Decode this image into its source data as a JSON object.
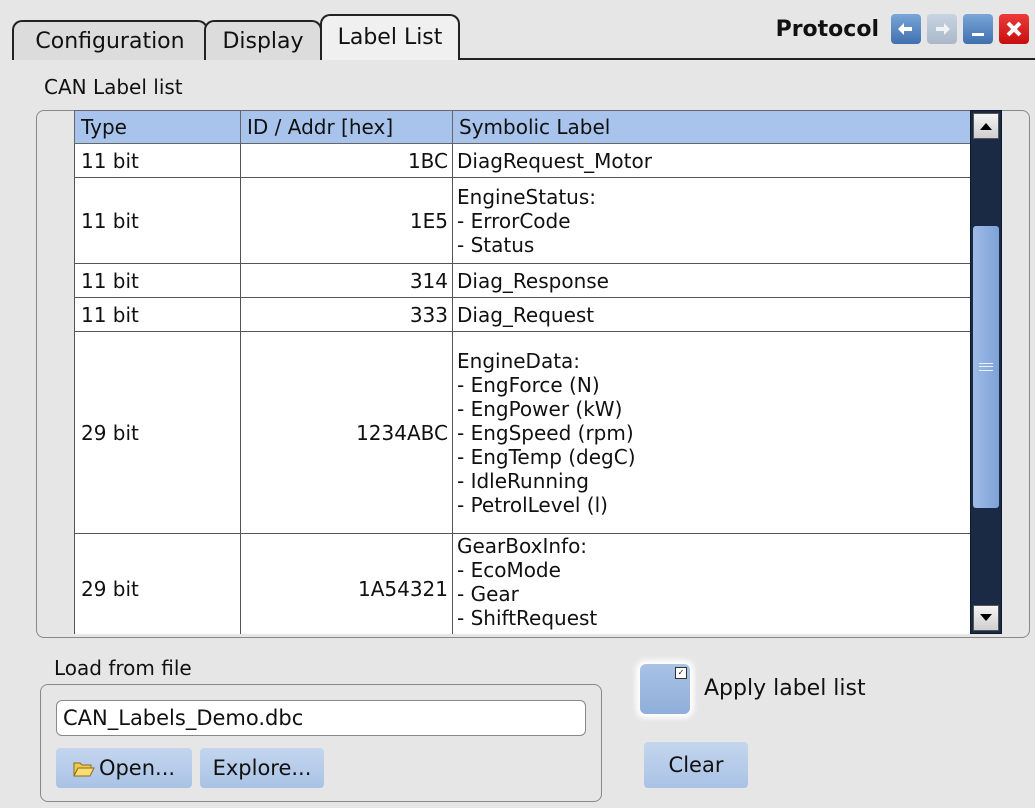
{
  "tabs": [
    {
      "label": "Configuration"
    },
    {
      "label": "Display"
    },
    {
      "label": "Label List"
    }
  ],
  "window": {
    "title": "Protocol",
    "undo_icon": "undo-arrow",
    "redo_icon": "redo-arrow",
    "minimize_icon": "minimize",
    "close_icon": "close-x",
    "accent": "#3f6fae",
    "close_color": "#c80f0f"
  },
  "label_list": {
    "group_title": "CAN Label list",
    "columns": [
      "Type",
      "ID / Addr [hex]",
      "Symbolic Label"
    ],
    "header_color": "#a8c4ec",
    "rows": [
      {
        "type": "11 bit",
        "id": "1BC",
        "label": "DiagRequest_Motor"
      },
      {
        "type": "11 bit",
        "id": "1E5",
        "label": "EngineStatus:\n- ErrorCode\n- Status"
      },
      {
        "type": "11 bit",
        "id": "314",
        "label": "Diag_Response"
      },
      {
        "type": "11 bit",
        "id": "333",
        "label": "Diag_Request"
      },
      {
        "type": "29 bit",
        "id": "1234ABC",
        "label": "EngineData:\n- EngForce (N)\n- EngPower (kW)\n- EngSpeed (rpm)\n- EngTemp (degC)\n- IdleRunning\n- PetrolLevel (l)"
      },
      {
        "type": "29 bit",
        "id": "1A54321",
        "label": "GearBoxInfo:\n- EcoMode\n- Gear\n- ShiftRequest"
      }
    ],
    "scroll_up_icon": "arrow-up",
    "scroll_down_icon": "arrow-down"
  },
  "load_from_file": {
    "group_title": "Load from file",
    "file_value": "CAN_Labels_Demo.dbc",
    "open_label": "Open...",
    "open_icon": "folder-open",
    "explore_label": "Explore..."
  },
  "apply": {
    "label": "Apply label list",
    "checked": true
  },
  "clear_label": "Clear"
}
